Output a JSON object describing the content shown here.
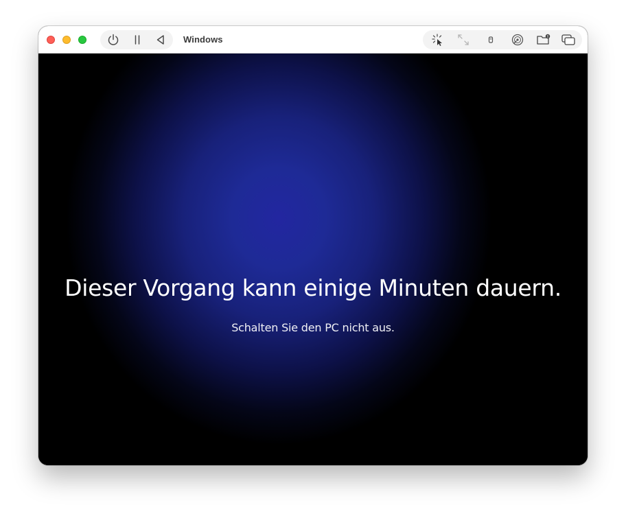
{
  "window": {
    "title": "Windows"
  },
  "toolbar": {
    "left_icons": [
      "power-icon",
      "pause-icon",
      "back-triangle-icon"
    ],
    "right_icons": [
      "capture-cursor-icon",
      "resize-arrows-icon",
      "usb-icon",
      "disk-icon",
      "shared-folder-icon",
      "windows-icon"
    ]
  },
  "screen": {
    "main_message": "Dieser Vorgang kann einige Minuten dauern.",
    "sub_message": "Schalten Sie den PC nicht aus."
  },
  "colors": {
    "close": "#fe5f57",
    "minimize": "#febc2e",
    "maximize": "#28c840",
    "screen_glow": "#2226a0",
    "screen_edge": "#000000"
  }
}
